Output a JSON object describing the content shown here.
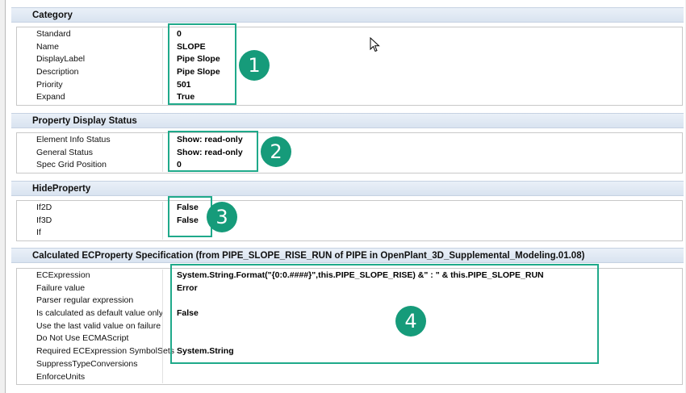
{
  "sections": [
    {
      "header": "Category",
      "rows": [
        {
          "name": "Standard",
          "value": "0"
        },
        {
          "name": "Name",
          "value": "SLOPE"
        },
        {
          "name": "DisplayLabel",
          "value": "Pipe Slope"
        },
        {
          "name": "Description",
          "value": "Pipe Slope"
        },
        {
          "name": "Priority",
          "value": "501"
        },
        {
          "name": "Expand",
          "value": "True"
        }
      ]
    },
    {
      "header": "Property Display Status",
      "rows": [
        {
          "name": "Element Info Status",
          "value": "Show: read-only"
        },
        {
          "name": "General Status",
          "value": "Show: read-only"
        },
        {
          "name": "Spec Grid Position",
          "value": "0"
        }
      ]
    },
    {
      "header": "HideProperty",
      "rows": [
        {
          "name": "If2D",
          "value": "False"
        },
        {
          "name": "If3D",
          "value": "False"
        },
        {
          "name": "If",
          "value": ""
        }
      ]
    },
    {
      "header": "Calculated ECProperty Specification (from PIPE_SLOPE_RISE_RUN of PIPE in OpenPlant_3D_Supplemental_Modeling.01.08)",
      "rows": [
        {
          "name": "ECExpression",
          "value": "System.String.Format(\"{0:0.####}\",this.PIPE_SLOPE_RISE) &\" : \" & this.PIPE_SLOPE_RUN"
        },
        {
          "name": "Failure value",
          "value": "Error"
        },
        {
          "name": "Parser regular expression",
          "value": ""
        },
        {
          "name": "Is calculated as default value only",
          "value": "False"
        },
        {
          "name": "Use the last valid value on failure",
          "value": ""
        },
        {
          "name": "Do Not Use ECMAScript",
          "value": ""
        },
        {
          "name": "Required ECExpression SymbolSets",
          "value": "System.String"
        },
        {
          "name": "SuppressTypeConversions",
          "value": ""
        },
        {
          "name": "EnforceUnits",
          "value": ""
        }
      ]
    }
  ],
  "callouts": [
    "1",
    "2",
    "3",
    "4"
  ],
  "colors": {
    "callout": "#1fa98a",
    "badge": "#169b7a",
    "header": "#dde6f2"
  }
}
